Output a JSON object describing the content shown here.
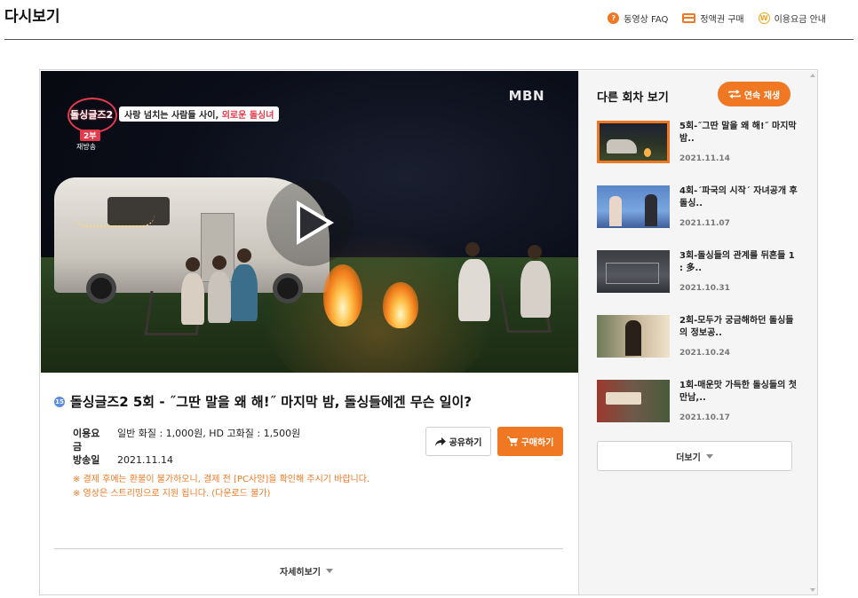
{
  "header": {
    "title": "다시보기",
    "links": [
      {
        "label": "동영상 FAQ",
        "icon": "question-icon"
      },
      {
        "label": "정액권 구매",
        "icon": "card-icon"
      },
      {
        "label": "이용요금 안내",
        "icon": "won-icon"
      }
    ]
  },
  "player": {
    "show_logo": "돌싱글즈2",
    "tagline_prefix": "사랑 넘치는 사람들 사이, ",
    "tagline_highlight": "외로운 돌싱녀",
    "part_badge": "2부",
    "rerun_label": "재방송",
    "channel": "MBN"
  },
  "episode": {
    "age_rating": "15",
    "title": "돌싱글즈2 5회 - ˝그딴 말을 왜 해!˝ 마지막 밤, 돌싱들에겐 무슨 일이?",
    "price_label": "이용요금",
    "price_value": "일반 화질 : 1,000원, HD 고화질 : 1,500원",
    "airdate_label": "방송일",
    "airdate_value": "2021.11.14",
    "share_label": "공유하기",
    "buy_label": "구매하기",
    "notices": [
      "※ 결제 후에는 환불이 불가하오니, 결제 전 [PC사양]을 확인해 주시기 바랍니다.",
      "※ 영상은 스트리밍으로 지원 됩니다. (다운로드 불가)"
    ],
    "more_detail_label": "자세히보기"
  },
  "sidebar": {
    "title": "다른 회차 보기",
    "continuous_play_label": "연속 재생",
    "episodes": [
      {
        "title": "5회-˝그딴 말을 왜 해!˝ 마지막 밤..",
        "date": "2021.11.14",
        "selected": true
      },
      {
        "title": "4회-´파국의 시작´ 자녀공개 후 돌싱..",
        "date": "2021.11.07",
        "selected": false
      },
      {
        "title": "3회-돌싱들의 관계를 뒤흔들 1 : 多..",
        "date": "2021.10.31",
        "selected": false
      },
      {
        "title": "2회-모두가 궁금해하던 돌싱들의 정보공..",
        "date": "2021.10.24",
        "selected": false
      },
      {
        "title": "1회-매운맛 가득한 돌싱들의 첫 만남,..",
        "date": "2021.10.17",
        "selected": false
      }
    ],
    "more_label": "더보기"
  },
  "colors": {
    "accent": "#f07823",
    "brand_red": "#e23a4c"
  }
}
